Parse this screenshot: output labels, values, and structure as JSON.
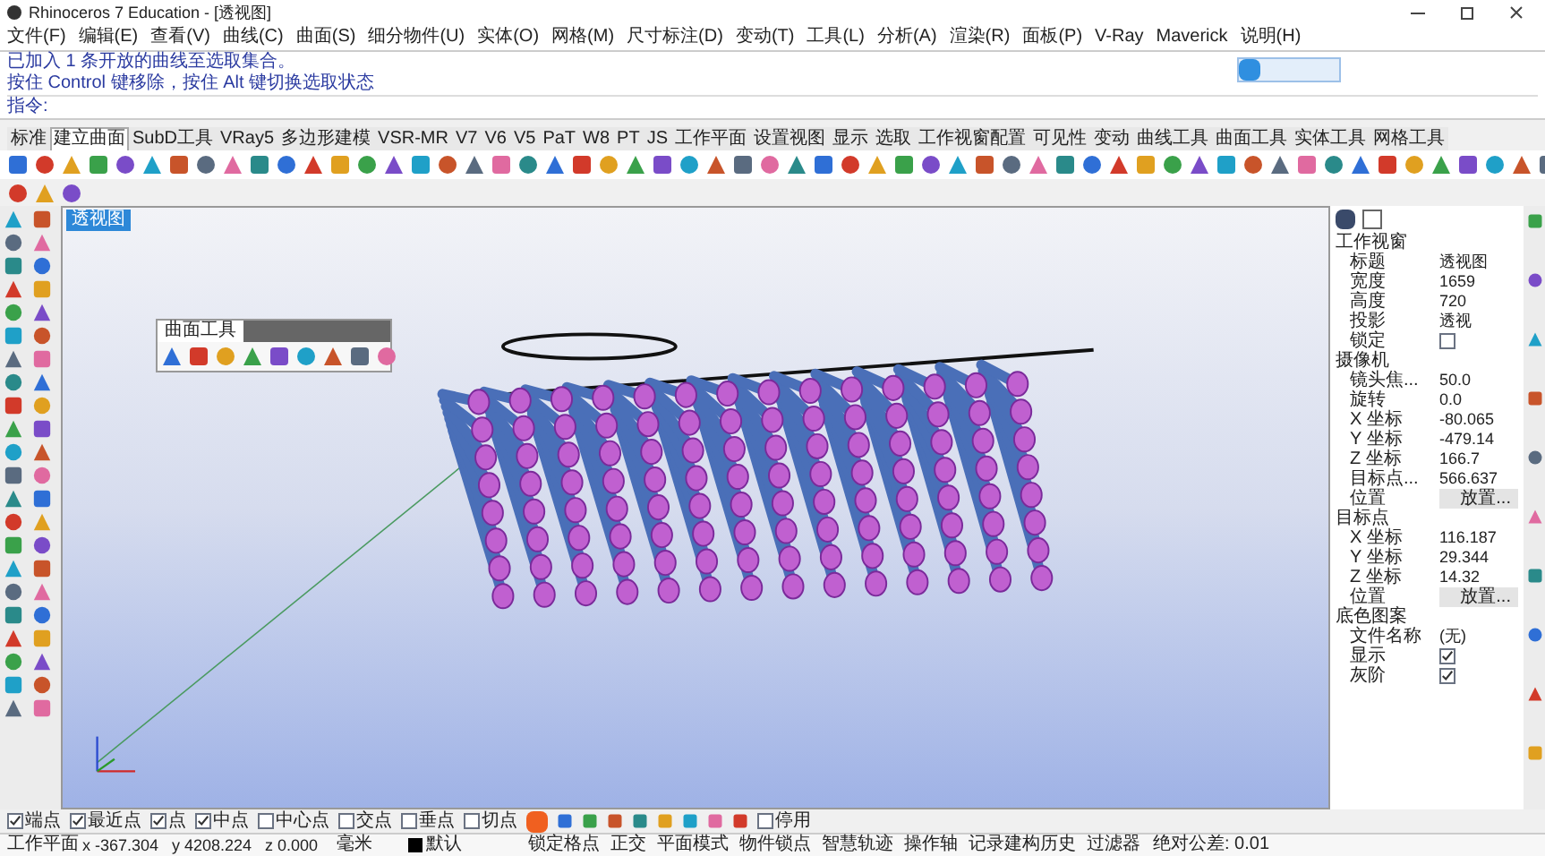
{
  "window": {
    "title": "Rhinoceros 7 Education - [透视图]"
  },
  "menu": [
    "文件(F)",
    "编辑(E)",
    "查看(V)",
    "曲线(C)",
    "曲面(S)",
    "细分物件(U)",
    "实体(O)",
    "网格(M)",
    "尺寸标注(D)",
    "变动(T)",
    "工具(L)",
    "分析(A)",
    "渲染(R)",
    "面板(P)",
    "V-Ray",
    "Maverick",
    "说明(H)"
  ],
  "command": {
    "history": [
      "已加入 1 条开放的曲线至选取集合。",
      "按住 Control 键移除，按住 Alt 键切换选取状态"
    ],
    "prompt": "指令:"
  },
  "tabs": [
    {
      "label": "标准",
      "selected": false
    },
    {
      "label": "建立曲面",
      "selected": true
    },
    {
      "label": "SubD工具",
      "selected": false
    },
    {
      "label": "VRay5",
      "selected": false
    },
    {
      "label": "多边形建模",
      "selected": false
    },
    {
      "label": "VSR-MR",
      "selected": false
    },
    {
      "label": "V7",
      "selected": false
    },
    {
      "label": "V6",
      "selected": false
    },
    {
      "label": "V5",
      "selected": false
    },
    {
      "label": "PaT",
      "selected": false
    },
    {
      "label": "W8",
      "selected": false
    },
    {
      "label": "PT",
      "selected": false
    },
    {
      "label": "JS",
      "selected": false
    },
    {
      "label": "工作平面",
      "selected": false
    },
    {
      "label": "设置视图",
      "selected": false
    },
    {
      "label": "显示",
      "selected": false
    },
    {
      "label": "选取",
      "selected": false
    },
    {
      "label": "工作视窗配置",
      "selected": false
    },
    {
      "label": "可见性",
      "selected": false
    },
    {
      "label": "变动",
      "selected": false
    },
    {
      "label": "曲线工具",
      "selected": false
    },
    {
      "label": "曲面工具",
      "selected": false
    },
    {
      "label": "实体工具",
      "selected": false
    },
    {
      "label": "网格工具",
      "selected": false
    }
  ],
  "viewport": {
    "label": "透视图",
    "floating_toolbar": {
      "title": "曲面工具"
    }
  },
  "properties": {
    "sections": [
      {
        "title": "工作视窗",
        "rows": [
          {
            "kind": "text",
            "label": "标题",
            "value": "透视图"
          },
          {
            "kind": "text",
            "label": "宽度",
            "value": "1659"
          },
          {
            "kind": "text",
            "label": "高度",
            "value": "720"
          },
          {
            "kind": "text",
            "label": "投影",
            "value": "透视"
          },
          {
            "kind": "check",
            "label": "锁定",
            "checked": false
          }
        ]
      },
      {
        "title": "摄像机",
        "rows": [
          {
            "kind": "text",
            "label": "镜头焦...",
            "value": "50.0"
          },
          {
            "kind": "text",
            "label": "旋转",
            "value": "0.0"
          },
          {
            "kind": "text",
            "label": "X 坐标",
            "value": "-80.065"
          },
          {
            "kind": "text",
            "label": "Y 坐标",
            "value": "-479.14"
          },
          {
            "kind": "text",
            "label": "Z 坐标",
            "value": "166.7"
          },
          {
            "kind": "text",
            "label": "目标点...",
            "value": "566.637"
          },
          {
            "kind": "button",
            "label": "位置",
            "value": "放置..."
          }
        ]
      },
      {
        "title": "目标点",
        "rows": [
          {
            "kind": "text",
            "label": "X 坐标",
            "value": "116.187"
          },
          {
            "kind": "text",
            "label": "Y 坐标",
            "value": "29.344"
          },
          {
            "kind": "text",
            "label": "Z 坐标",
            "value": "14.32"
          },
          {
            "kind": "button",
            "label": "位置",
            "value": "放置..."
          }
        ]
      },
      {
        "title": "底色图案",
        "rows": [
          {
            "kind": "text",
            "label": "文件名称",
            "value": "(无)"
          },
          {
            "kind": "check",
            "label": "显示",
            "checked": true
          },
          {
            "kind": "check",
            "label": "灰阶",
            "checked": true
          }
        ]
      }
    ]
  },
  "osnaps": [
    {
      "label": "端点",
      "checked": true
    },
    {
      "label": "最近点",
      "checked": true
    },
    {
      "label": "点",
      "checked": true
    },
    {
      "label": "中点",
      "checked": true
    },
    {
      "label": "中心点",
      "checked": false
    },
    {
      "label": "交点",
      "checked": false
    },
    {
      "label": "垂点",
      "checked": false
    },
    {
      "label": "切点",
      "checked": false
    }
  ],
  "osnap_disable": {
    "label": "停用",
    "checked": false
  },
  "status_bar": {
    "plane": "工作平面",
    "x": "x -367.304",
    "y": "y 4208.224",
    "z": "z 0.000",
    "units": "毫米",
    "layer": "默认",
    "toggles": [
      "锁定格点",
      "正交",
      "平面模式",
      "物件锁点",
      "智慧轨迹",
      "操作轴",
      "记录建构历史",
      "过滤器"
    ],
    "tolerance": "绝对公差: 0.01"
  }
}
